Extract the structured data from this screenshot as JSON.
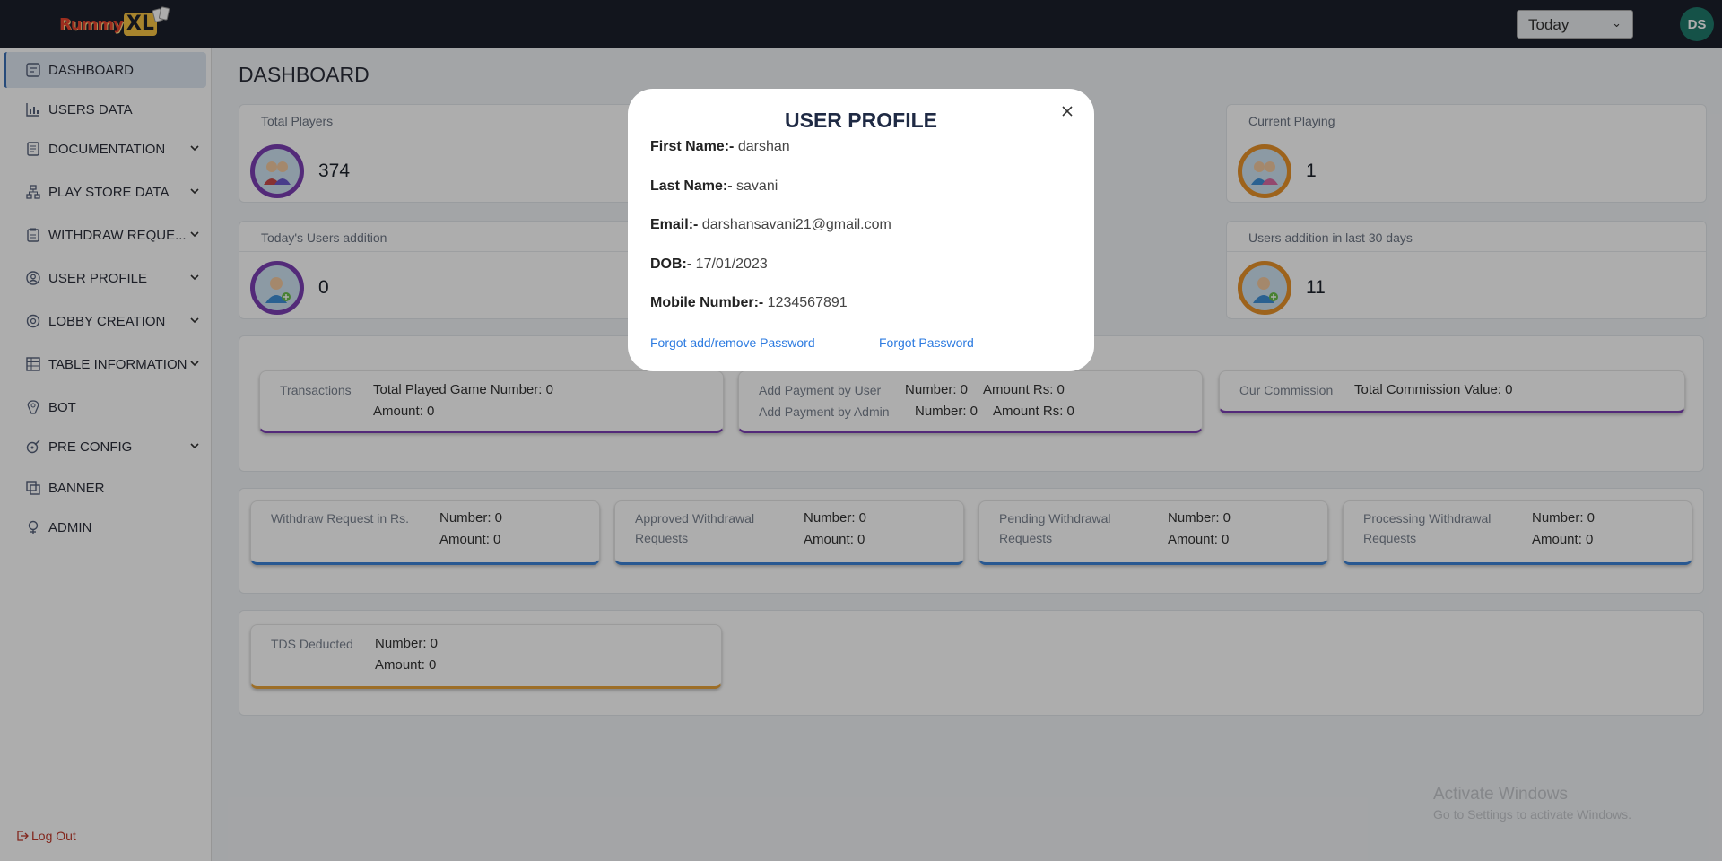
{
  "app": {
    "logo_text": "Rummy",
    "logo_xl": "XL"
  },
  "topbar": {
    "date_filter": "Today",
    "user_initials": "DS"
  },
  "sidebar": {
    "items": [
      {
        "label": "DASHBOARD",
        "icon": "dashboard-icon",
        "active": true
      },
      {
        "label": "USERS DATA",
        "icon": "chart-icon"
      },
      {
        "label": "DOCUMENTATION",
        "icon": "document-icon",
        "expandable": true
      },
      {
        "label": "PLAY STORE DATA",
        "icon": "hierarchy-icon",
        "expandable": true
      },
      {
        "label": "WITHDRAW REQUE...",
        "icon": "clipboard-icon",
        "expandable": true
      },
      {
        "label": "USER PROFILE",
        "icon": "user-circle-icon",
        "expandable": true
      },
      {
        "label": "LOBBY CREATION",
        "icon": "settings-icon",
        "expandable": true
      },
      {
        "label": "TABLE INFORMATION",
        "icon": "table-icon",
        "expandable": true
      },
      {
        "label": "BOT",
        "icon": "bot-icon"
      },
      {
        "label": "PRE CONFIG",
        "icon": "config-icon",
        "expandable": true
      },
      {
        "label": "BANNER",
        "icon": "banner-icon"
      },
      {
        "label": "ADMIN",
        "icon": "admin-icon"
      }
    ],
    "logout": "Log Out"
  },
  "main": {
    "title": "DASHBOARD",
    "stats": [
      {
        "label": "Total Players",
        "value": "374"
      },
      {
        "label": "Current Playing",
        "value": "1"
      },
      {
        "label": "Today's Users addition",
        "value": "0"
      },
      {
        "label": "Users addition in last 30 days",
        "value": "11"
      }
    ],
    "transactions": {
      "label": "Transactions",
      "line1": "Total Played Game Number: 0",
      "line2": "Amount: 0"
    },
    "payments": {
      "by_user_label": "Add Payment by User",
      "by_user_number": "Number: 0",
      "by_user_amount": "Amount Rs: 0",
      "by_admin_label": "Add Payment by Admin",
      "by_admin_number": "Number: 0",
      "by_admin_amount": "Amount Rs: 0"
    },
    "commission": {
      "label": "Our Commission",
      "value": "Total Commission Value: 0"
    },
    "withdrawals": [
      {
        "label": "Withdraw Request in Rs.",
        "number": "Number: 0",
        "amount": "Amount: 0"
      },
      {
        "label": "Approved Withdrawal Requests",
        "number": "Number: 0",
        "amount": "Amount: 0"
      },
      {
        "label": "Pending Withdrawal Requests",
        "number": "Number: 0",
        "amount": "Amount: 0"
      },
      {
        "label": "Processing Withdrawal Requests",
        "number": "Number: 0",
        "amount": "Amount: 0"
      }
    ],
    "tds": {
      "label": "TDS Deducted",
      "number": "Number: 0",
      "amount": "Amount: 0"
    }
  },
  "watermark": {
    "line1": "Activate Windows",
    "line2": "Go to Settings to activate Windows."
  },
  "modal": {
    "title": "USER PROFILE",
    "fields": [
      {
        "label": "First Name:-",
        "value": "darshan"
      },
      {
        "label": "Last Name:-",
        "value": "savani"
      },
      {
        "label": "Email:-",
        "value": "darshansavani21@gmail.com"
      },
      {
        "label": "DOB:-",
        "value": "17/01/2023"
      },
      {
        "label": "Mobile Number:-",
        "value": "1234567891"
      }
    ],
    "link_forgot_add_remove": "Forgot add/remove Password",
    "link_forgot": "Forgot Password"
  }
}
